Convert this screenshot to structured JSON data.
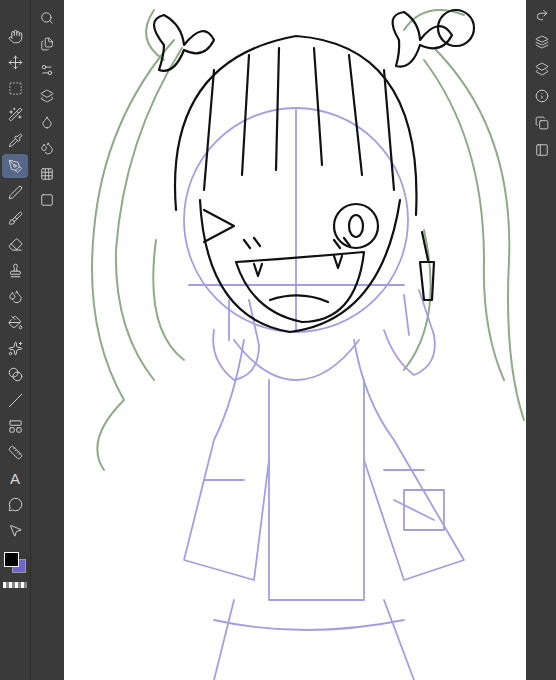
{
  "toolbar": {
    "tools": [
      {
        "selected": false
      },
      {
        "selected": false
      },
      {
        "selected": false
      },
      {
        "selected": false
      },
      {
        "selected": false
      },
      {
        "selected": true
      },
      {
        "selected": false
      },
      {
        "selected": false
      },
      {
        "selected": false
      },
      {
        "selected": false
      },
      {
        "selected": false
      },
      {
        "selected": false
      },
      {
        "selected": false
      },
      {
        "selected": false
      },
      {
        "selected": false
      },
      {
        "selected": false
      },
      {
        "selected": false
      },
      {
        "label": "A",
        "selected": false
      },
      {
        "selected": false
      },
      {
        "selected": false
      }
    ],
    "sub_tools": [
      {
        "selected": false
      },
      {
        "selected": false
      },
      {
        "selected": false
      },
      {
        "selected": false
      },
      {
        "selected": false
      },
      {
        "selected": false
      },
      {
        "selected": false
      },
      {
        "selected": false
      }
    ],
    "color_swatches": [
      {
        "color": "#000000",
        "selected": true
      },
      {
        "color": "#6e63d6",
        "selected": false
      }
    ]
  },
  "right_panel": {
    "buttons": [
      {
        "selected": false
      },
      {
        "selected": false
      },
      {
        "selected": false
      },
      {
        "selected": false
      },
      {
        "selected": false
      },
      {
        "selected": false
      }
    ]
  }
}
